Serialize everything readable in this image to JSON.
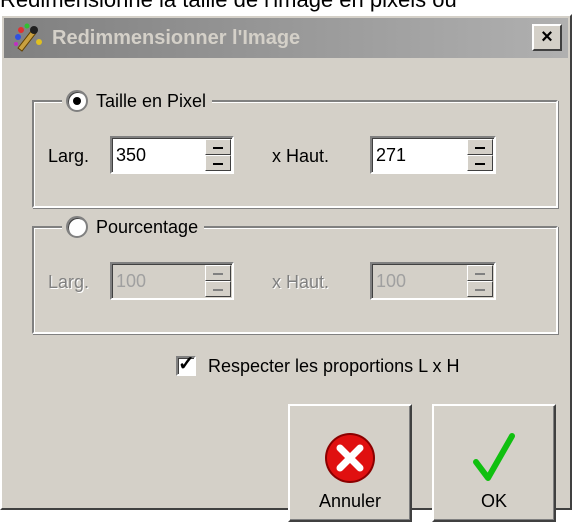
{
  "document": {
    "text_above": "Redimensionne la taille de l'image en pixels ou"
  },
  "window": {
    "title": "Redimmensionner l'Image",
    "close_glyph": "×",
    "icon": "paint-palette-icon"
  },
  "pixel_group": {
    "label": "Taille en Pixel",
    "selected": true,
    "width_label": "Larg.",
    "width_value": "350",
    "height_label": "x Haut.",
    "height_value": "271"
  },
  "percent_group": {
    "label": "Pourcentage",
    "selected": false,
    "width_label": "Larg.",
    "width_value": "100",
    "height_label": "x Haut.",
    "height_value": "100"
  },
  "keep_ratio": {
    "label": "Respecter les proportions L x H",
    "checked": true,
    "check_glyph": "✓"
  },
  "buttons": {
    "cancel_label": "Annuler",
    "cancel_icon": "cancel-x-icon",
    "ok_label": "OK",
    "ok_icon": "checkmark-icon"
  },
  "colors": {
    "dialog_bg": "#d4d0c8",
    "titlebar_start": "#808080",
    "titlebar_end": "#b0b0b0",
    "cancel_red": "#e01010",
    "ok_green": "#10c010"
  }
}
